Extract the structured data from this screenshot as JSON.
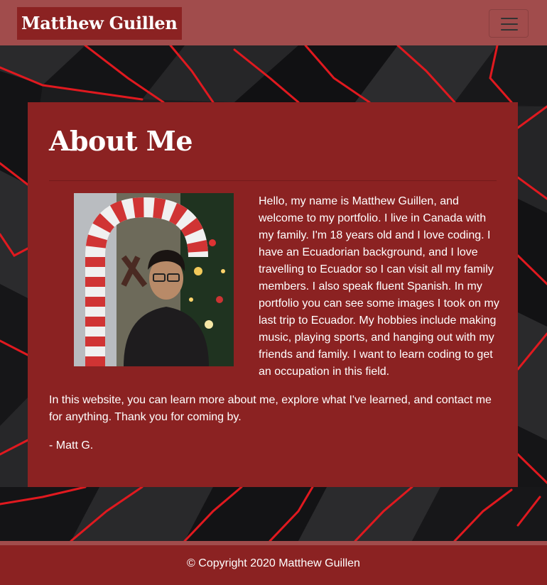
{
  "navbar": {
    "brand": "Matthew Guillen",
    "toggler_icon": "hamburger-menu-icon"
  },
  "about": {
    "title": "About Me",
    "bio": "Hello, my name is Matthew Guillen, and welcome to my portfolio. I live in Canada with my family. I'm 18 years old and I love coding. I have an Ecuadorian background, and I love travelling to Ecuador so I can visit all my family members. I also speak fluent Spanish. In my portfolio you can see some images I took on my last trip to Ecuador. My hobbies include making music, playing sports, and hanging out with my friends and family. I want to learn coding to get an occupation in this field.",
    "closing": "In this website, you can learn more about me, explore what I've learned, and contact me for anything. Thank you for coming by.",
    "signature": "- Matt G."
  },
  "footer": {
    "copyright": "© Copyright 2020 Matthew Guillen"
  },
  "colors": {
    "navbar": "#a14c4c",
    "brand_bg": "#8b2222",
    "card_bg": "#8b2222",
    "accent_red": "#e0191f",
    "background_dark": "#1a1a1c"
  }
}
